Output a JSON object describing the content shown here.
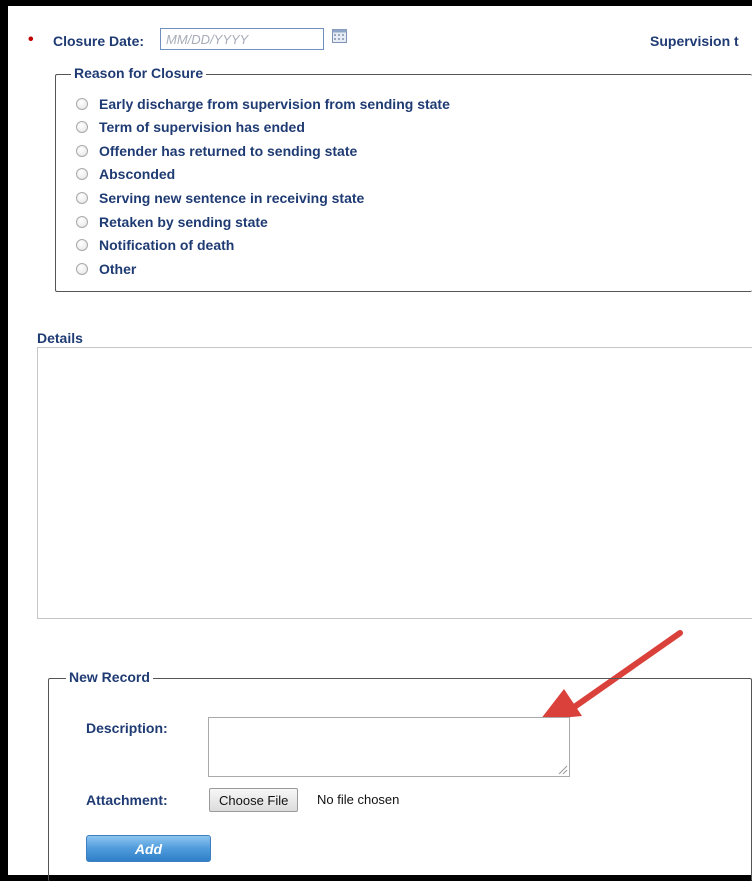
{
  "closure": {
    "required_marker": "•",
    "label": "Closure Date:",
    "date_placeholder": "MM/DD/YYYY",
    "calendar_icon": "calendar-icon"
  },
  "supervision_label": "Supervision t",
  "reason_for_closure": {
    "legend": "Reason for Closure",
    "options": [
      "Early discharge from supervision from sending state",
      "Term of supervision has ended",
      "Offender has returned to sending state",
      "Absconded",
      "Serving new sentence in receiving state",
      "Retaken by sending state",
      "Notification of death",
      "Other"
    ]
  },
  "details": {
    "label": "Details",
    "value": ""
  },
  "new_record": {
    "legend": "New Record",
    "description_label": "Description:",
    "description_value": "",
    "attachment_label": "Attachment:",
    "choose_file_label": "Choose File",
    "no_file_text": "No file chosen",
    "add_label": "Add"
  },
  "colors": {
    "label_text": "#1f3b73",
    "required": "#c00000",
    "add_button": "#4f9bdc",
    "arrow": "#d9413a"
  }
}
